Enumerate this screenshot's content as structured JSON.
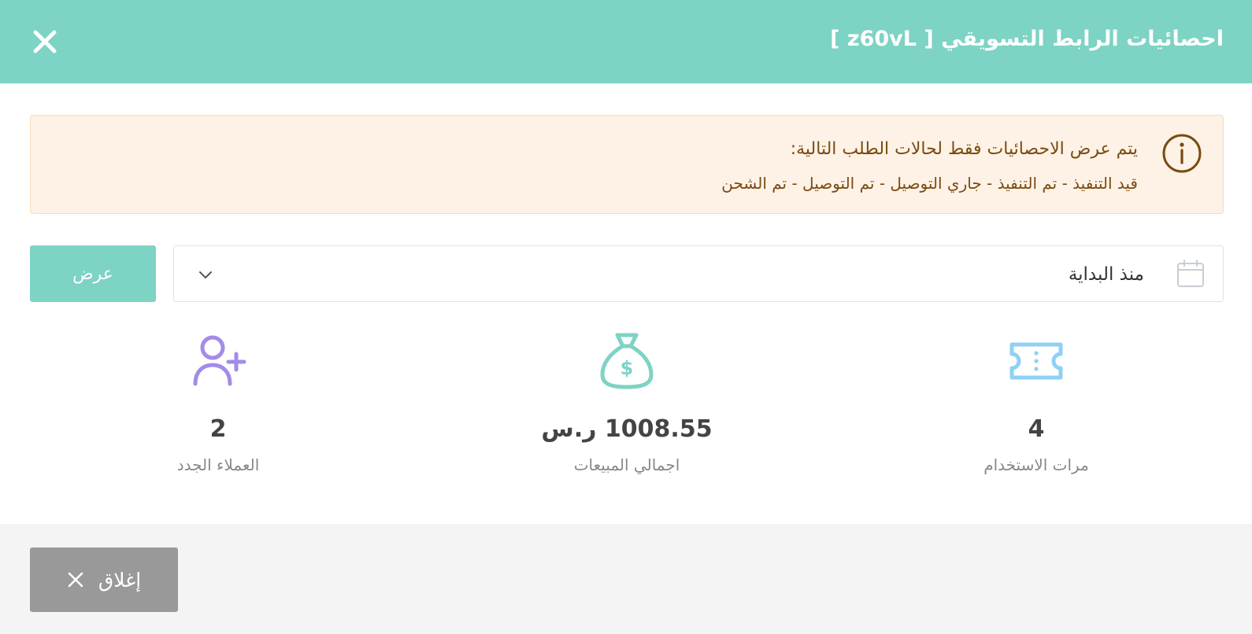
{
  "header": {
    "title": "احصائيات الرابط التسويقي [ z60vL ]",
    "close_icon": "close-icon"
  },
  "alert": {
    "icon": "info-icon",
    "line1": "يتم عرض الاحصائيات فقط لحالات الطلب التالية:",
    "line2": "قيد التنفيذ - تم التنفيذ - جاري التوصيل - تم التوصيل - تم الشحن"
  },
  "filter": {
    "selected_value": "منذ البداية",
    "calendar_icon": "calendar-icon",
    "chevron_icon": "chevron-down-icon",
    "show_button_label": "عرض"
  },
  "stats": {
    "usage": {
      "icon": "ticket-icon",
      "value": "4",
      "label": "مرات الاستخدام",
      "color": "#8fd0f5"
    },
    "sales": {
      "icon": "money-bag-icon",
      "value": "1008.55 ر.س",
      "label": "اجمالي المبيعات",
      "color": "#7dd3c4"
    },
    "customers": {
      "icon": "user-add-icon",
      "value": "2",
      "label": "العملاء الجدد",
      "color": "#a48be8"
    }
  },
  "footer": {
    "close_button_label": "إغلاق",
    "close_icon": "close-icon"
  },
  "colors": {
    "accent": "#7dd3c4",
    "alert_bg": "#fdf2e5",
    "alert_text": "#7a4a12",
    "footer_button": "#999999"
  }
}
